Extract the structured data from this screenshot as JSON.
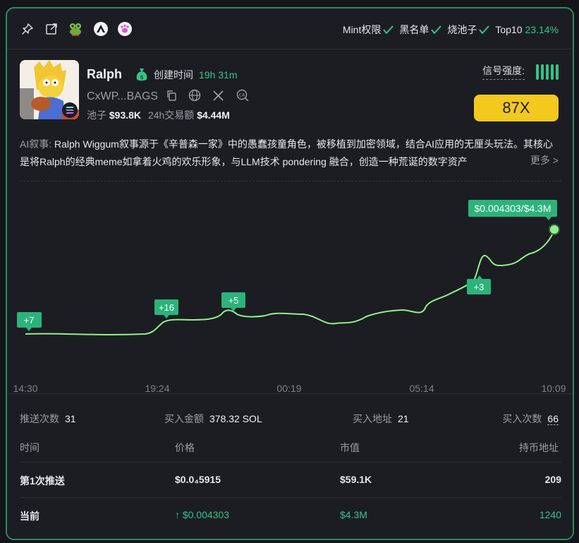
{
  "topbar": {
    "icons": [
      "pin-icon",
      "external-link-icon",
      "frog-icon",
      "triangle-icon",
      "paw-icon"
    ],
    "checks": [
      {
        "label": "Mint权限",
        "status": "check"
      },
      {
        "label": "黑名单",
        "status": "check"
      },
      {
        "label": "烧池子",
        "status": "check"
      }
    ],
    "top10_label": "Top10",
    "top10_value": "23.14%"
  },
  "token": {
    "name": "Ralph",
    "created_label": "创建时间",
    "created_value": "19h 31m",
    "address": "CxWP...BAGS",
    "pool_label": "池子",
    "pool_value": "$93.8K",
    "volume_label": "24h交易额",
    "volume_value": "$4.44M"
  },
  "signal": {
    "label": "信号强度:",
    "bars": 5,
    "multiplier": "87X"
  },
  "story": {
    "label": "AI叙事:",
    "text": "Ralph Wiggum叙事源于《辛普森一家》中的愚蠢孩童角色，被移植到加密领域，结合AI应用的无厘头玩法。其核心是将Ralph的经典meme如拿着火鸡的欢乐形象，与LLM技术 pondering 融合，创造一种荒诞的数字资产",
    "more": "更多 >"
  },
  "chart_data": {
    "type": "line",
    "x_ticks": [
      "14:30",
      "19:24",
      "00:19",
      "05:14",
      "10:09"
    ],
    "current_label": "$0.004303/$4.3M",
    "color": "#8ef28a",
    "push_markers": [
      "+7",
      "+16",
      "+5",
      "+3"
    ]
  },
  "summary": {
    "push_count_label": "推送次数",
    "push_count": "31",
    "buy_amount_label": "买入金额",
    "buy_amount": "378.32 SOL",
    "buy_addr_label": "买入地址",
    "buy_addr": "21",
    "buy_times_label": "买入次数",
    "buy_times": "66"
  },
  "table": {
    "headers": [
      "时间",
      "价格",
      "市值",
      "持币地址"
    ],
    "rows": [
      {
        "time": "第1次推送",
        "price": "$0.0₄5915",
        "mcap": "$59.1K",
        "holders": "209"
      },
      {
        "time": "当前",
        "price": "↑ $0.004303",
        "mcap": "$4.3M",
        "holders": "1240"
      }
    ]
  },
  "colors": {
    "accent": "#33c48a",
    "multiplier_bg": "#f3c91d",
    "line": "#8ef28a"
  }
}
